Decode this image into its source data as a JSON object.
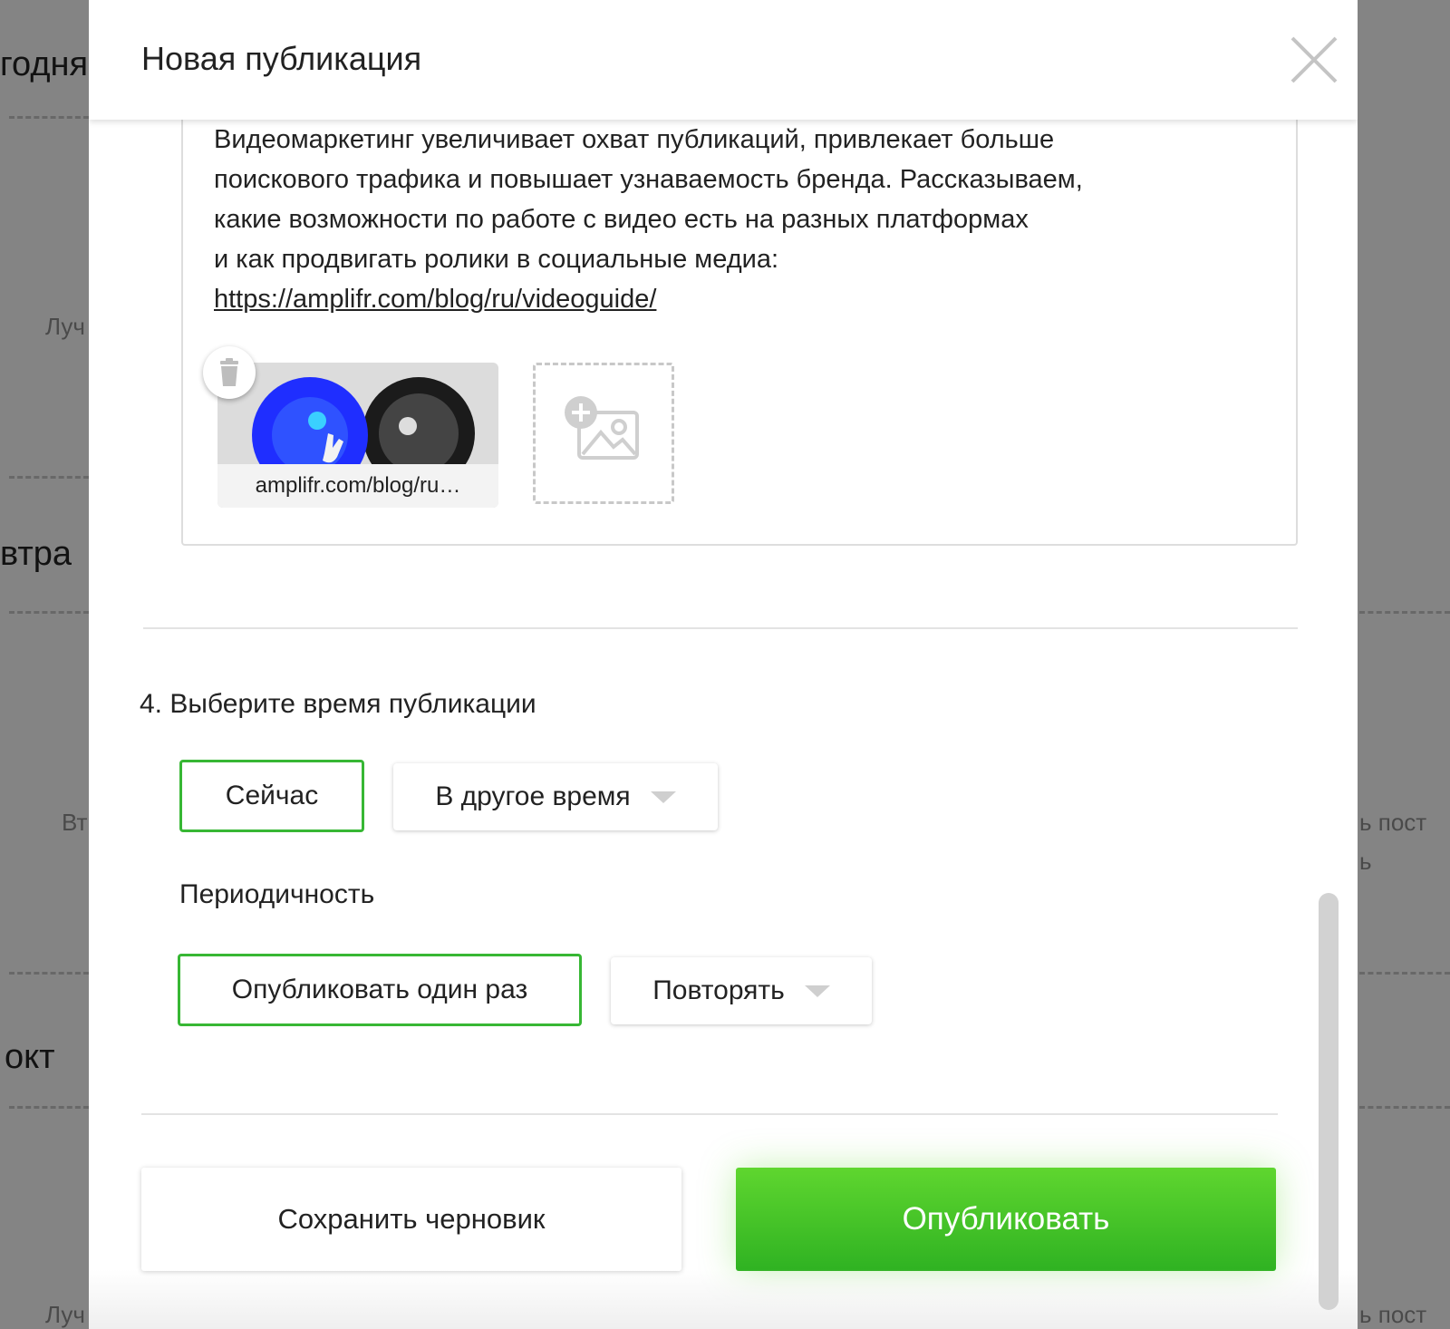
{
  "background": {
    "day_labels": [
      "годня",
      "втра",
      "окт"
    ],
    "cell_texts_left": [
      "Луч",
      "Вт",
      "Луч"
    ],
    "cell_texts_right": [
      "ь пост",
      "ь",
      "ь пост"
    ]
  },
  "modal": {
    "title": "Новая публикация",
    "post": {
      "lines": [
        "Видеомаркетинг увеличивает охват публикаций, привлекает больше",
        "поискового трафика и повышает узнаваемость бренда. Рассказываем,",
        "какие возможности по работе с видео есть на разных платформах",
        "и как продвигать ролики в социальные медиа:"
      ],
      "link": "https://amplifr.com/blog/ru/videoguide/"
    },
    "attachment": {
      "caption": "amplifr.com/blog/ru…"
    },
    "step4": {
      "label": "4.  Выберите время публикации",
      "now_button": "Сейчас",
      "other_time_button": "В другое время"
    },
    "periodicity": {
      "label": "Периодичность",
      "once_button": "Опубликовать один раз",
      "repeat_button": "Повторять"
    },
    "footer": {
      "save_draft_button": "Сохранить черновик",
      "publish_button": "Опубликовать"
    },
    "colors": {
      "selected_border": "#37b734",
      "publish_green": "#3cc026"
    }
  }
}
